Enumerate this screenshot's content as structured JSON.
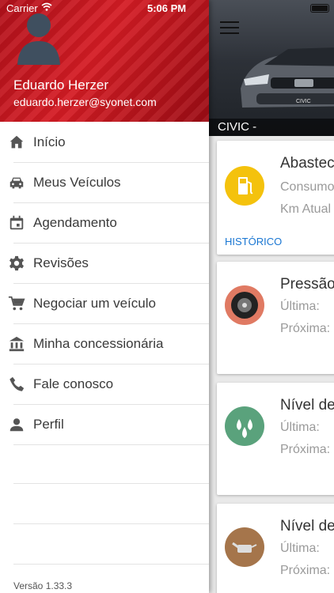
{
  "status_bar": {
    "carrier": "Carrier",
    "time": "5:06 PM"
  },
  "drawer": {
    "user": {
      "name": "Eduardo Herzer",
      "email": "eduardo.herzer@syonet.com"
    },
    "menu": [
      {
        "label": "Início",
        "icon": "home-icon"
      },
      {
        "label": "Meus Veículos",
        "icon": "car-icon"
      },
      {
        "label": "Agendamento",
        "icon": "calendar-icon"
      },
      {
        "label": "Revisões",
        "icon": "gear-icon"
      },
      {
        "label": "Negociar um veículo",
        "icon": "cart-icon"
      },
      {
        "label": "Minha concessionária",
        "icon": "bank-icon"
      },
      {
        "label": "Fale conosco",
        "icon": "phone-icon"
      },
      {
        "label": "Perfil",
        "icon": "person-icon"
      }
    ],
    "version": "Versão 1.33.3"
  },
  "main": {
    "vehicle_caption": "CIVIC  -",
    "cards": [
      {
        "title": "Abasteci",
        "lines": [
          "Consumo",
          "Km Atual"
        ],
        "link": "HISTÓRICO",
        "icon": "fuel-pump-icon",
        "icon_color": "#f4c20d"
      },
      {
        "title": "Pressão",
        "lines": [
          "Última:",
          "Próxima:"
        ],
        "icon": "tire-icon",
        "icon_color": "#e07a63"
      },
      {
        "title": "Nível de",
        "lines": [
          "Última:",
          "Próxima:"
        ],
        "icon": "water-drops-icon",
        "icon_color": "#5aa27c"
      },
      {
        "title": "Nível de",
        "lines": [
          "Última:",
          "Próxima:"
        ],
        "icon": "oil-can-icon",
        "icon_color": "#a5754b"
      }
    ]
  }
}
